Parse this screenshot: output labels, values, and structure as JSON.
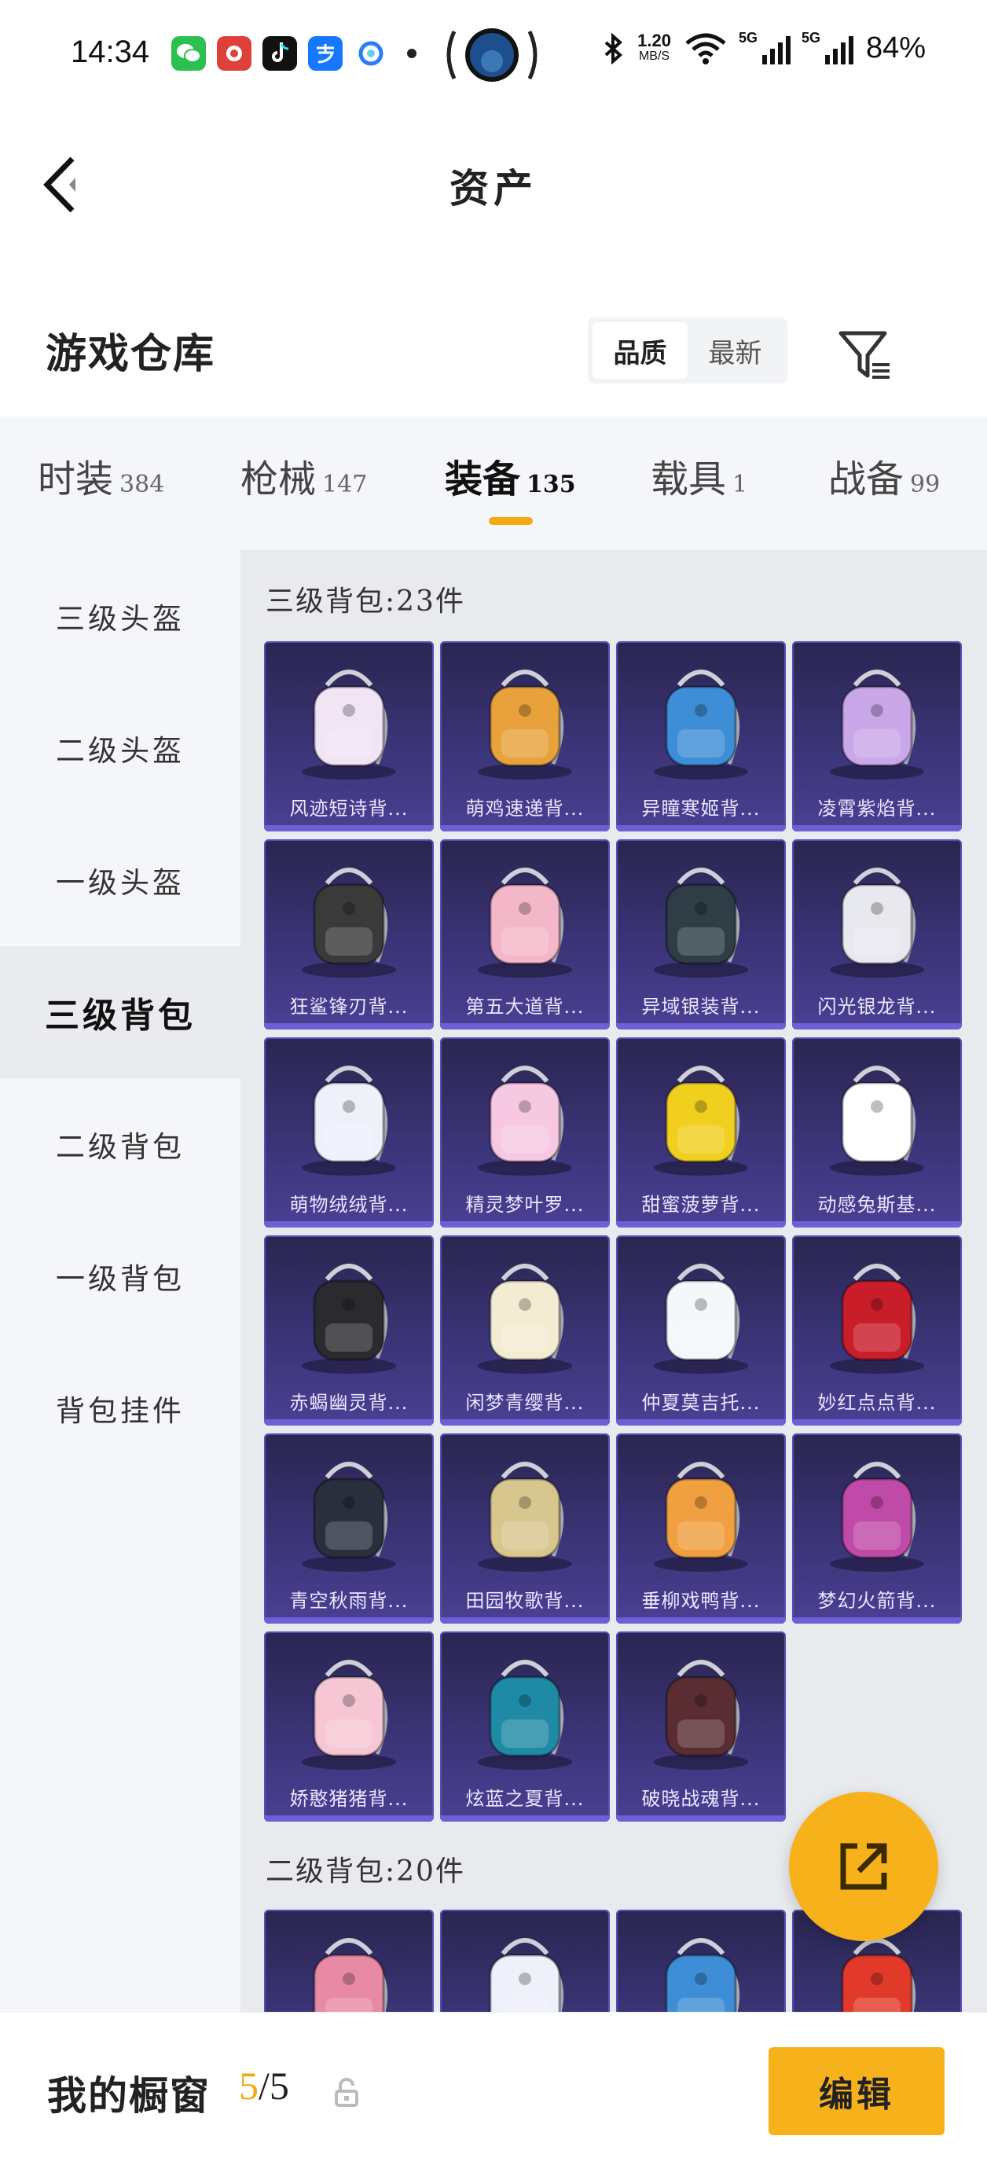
{
  "status_bar": {
    "time": "14:34",
    "speed_value": "1.20",
    "speed_unit": "MB/S",
    "battery": "84%",
    "network_1": "5G",
    "network_2": "5G",
    "app_icons": [
      "wechat-icon",
      "meituan-icon",
      "tiktok-icon",
      "alipay-icon",
      "browser-icon"
    ]
  },
  "header": {
    "title": "资产"
  },
  "warehouse": {
    "title": "游戏仓库",
    "sort_options": [
      "品质",
      "最新"
    ],
    "sort_selected": "品质"
  },
  "tabs": [
    {
      "label": "时装",
      "count": "384"
    },
    {
      "label": "枪械",
      "count": "147"
    },
    {
      "label": "装备",
      "count": "135"
    },
    {
      "label": "载具",
      "count": "1"
    },
    {
      "label": "战备",
      "count": "99"
    }
  ],
  "active_tab": "装备",
  "sidenav": [
    {
      "label": "三级头盔"
    },
    {
      "label": "二级头盔"
    },
    {
      "label": "一级头盔"
    },
    {
      "label": "三级背包"
    },
    {
      "label": "二级背包"
    },
    {
      "label": "一级背包"
    },
    {
      "label": "背包挂件"
    }
  ],
  "active_sidenav": "三级背包",
  "sections": [
    {
      "label": "三级背包:23件",
      "items": [
        {
          "name": "风迹短诗背...",
          "color": "#f1e4f5"
        },
        {
          "name": "萌鸡速递背...",
          "color": "#e9a23b"
        },
        {
          "name": "异瞳寒姬背...",
          "color": "#3d8ed6"
        },
        {
          "name": "凌霄紫焰背...",
          "color": "#c9a7e8"
        },
        {
          "name": "狂鲨锋刃背...",
          "color": "#3a3a3a"
        },
        {
          "name": "第五大道背...",
          "color": "#f4b7c9"
        },
        {
          "name": "异域银装背...",
          "color": "#2f3d46"
        },
        {
          "name": "闪光银龙背...",
          "color": "#e8e8ef"
        },
        {
          "name": "萌物绒绒背...",
          "color": "#eef0fa"
        },
        {
          "name": "精灵梦叶罗...",
          "color": "#f7c8e2"
        },
        {
          "name": "甜蜜菠萝背...",
          "color": "#f1cf1f"
        },
        {
          "name": "动感兔斯基...",
          "color": "#ffffff"
        },
        {
          "name": "赤蝎幽灵背...",
          "color": "#2b2b2f"
        },
        {
          "name": "闲梦青缨背...",
          "color": "#f3ecd2"
        },
        {
          "name": "仲夏莫吉托...",
          "color": "#f5f7fb"
        },
        {
          "name": "妙红点点背...",
          "color": "#c91d2a"
        },
        {
          "name": "青空秋雨背...",
          "color": "#2a2f3d"
        },
        {
          "name": "田园牧歌背...",
          "color": "#d8c68f"
        },
        {
          "name": "垂柳戏鸭背...",
          "color": "#f0a040"
        },
        {
          "name": "梦幻火箭背...",
          "color": "#c04aa8"
        },
        {
          "name": "娇憨猪猪背...",
          "color": "#f6c6d4"
        },
        {
          "name": "炫蓝之夏背...",
          "color": "#1f8aa6"
        },
        {
          "name": "破晓战魂背...",
          "color": "#5a2d33"
        }
      ]
    },
    {
      "label": "二级背包:20件",
      "items": [
        {
          "name": "",
          "color": "#e88aa5"
        },
        {
          "name": "",
          "color": "#eef0fa"
        },
        {
          "name": "",
          "color": "#3d8ed6"
        },
        {
          "name": "",
          "color": "#e23a2a"
        }
      ]
    }
  ],
  "showcase": {
    "label": "我的橱窗",
    "current": "5",
    "total": "/5",
    "edit_label": "编辑"
  },
  "colors": {
    "accent": "#f7b11b",
    "card_bg": "#3b3477",
    "panel_bg": "#f4f6f9"
  }
}
